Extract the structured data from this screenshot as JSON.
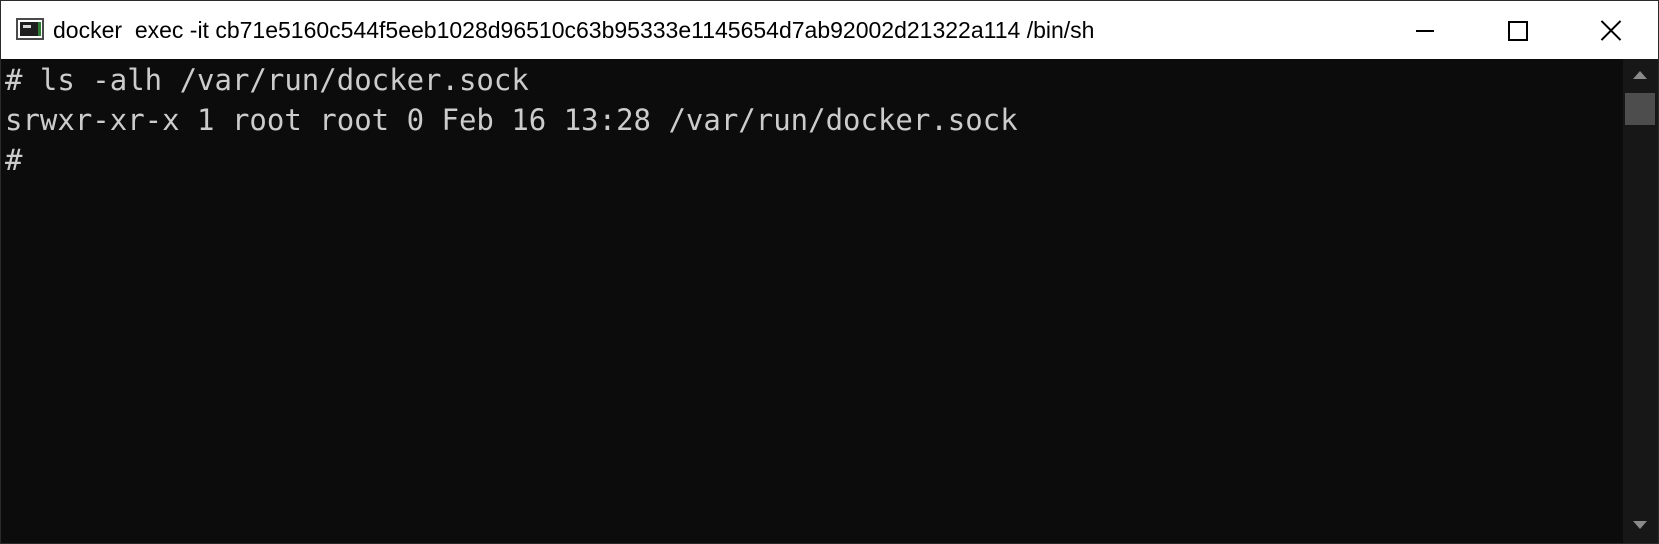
{
  "window": {
    "title": "docker  exec -it cb71e5160c544f5eeb1028d96510c63b95333e1145654d7ab92002d21322a114 /bin/sh",
    "icon": "console-app-icon",
    "controls": {
      "minimize_icon": "minimize-icon",
      "maximize_icon": "maximize-icon",
      "close_icon": "close-icon"
    }
  },
  "terminal": {
    "lines": [
      "# ls -alh /var/run/docker.sock",
      "srwxr-xr-x 1 root root 0 Feb 16 13:28 /var/run/docker.sock",
      "#"
    ],
    "colors": {
      "background": "#0c0c0c",
      "foreground": "#cccccc"
    }
  },
  "scrollbar": {
    "up_icon": "scroll-up-arrow-icon",
    "down_icon": "scroll-down-arrow-icon"
  }
}
